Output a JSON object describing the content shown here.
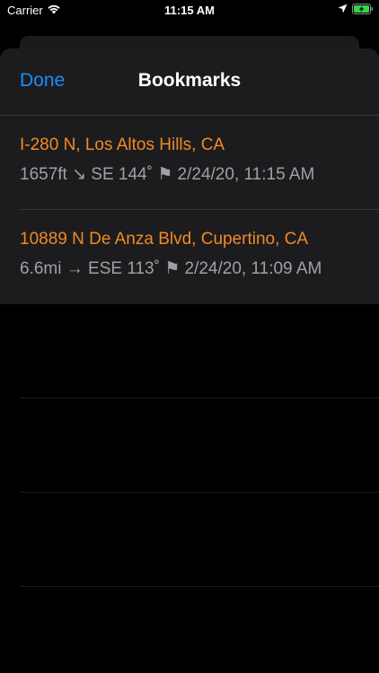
{
  "status_bar": {
    "carrier": "Carrier",
    "time": "11:15 AM",
    "icons": [
      "wifi-icon",
      "location-arrow-icon",
      "battery-charging-icon"
    ],
    "battery_color": "#32d74b"
  },
  "nav": {
    "done_label": "Done",
    "title": "Bookmarks"
  },
  "colors": {
    "accent": "#1a8cff",
    "title_orange": "#f08a24",
    "subtitle_gray": "#a0a0a5",
    "row_background": "#1c1c1e"
  },
  "bookmarks": [
    {
      "title": "I-280 N, Los Altos Hills, CA",
      "subtitle": "1657ft ↘ SE 144˚ ⚑ 2/24/20, 11:15 AM"
    },
    {
      "title": "10889 N De Anza Blvd, Cupertino, CA",
      "subtitle": "6.6mi → ESE 113˚ ⚑ 2/24/20, 11:09 AM"
    }
  ]
}
